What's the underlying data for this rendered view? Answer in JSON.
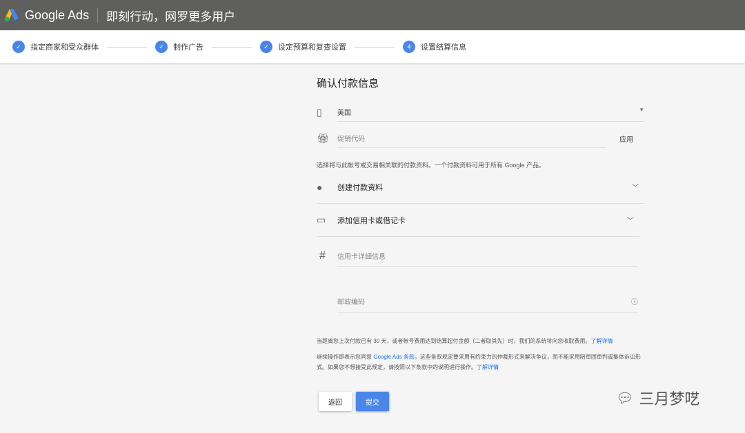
{
  "header": {
    "brand": "Google Ads",
    "tagline": "即刻行动，网罗更多用户"
  },
  "steps": [
    {
      "label": "指定商家和受众群体",
      "state": "done"
    },
    {
      "label": "制作广告",
      "state": "done"
    },
    {
      "label": "设定预算和复查设置",
      "state": "done"
    },
    {
      "label": "设置结算信息",
      "number": "4",
      "state": "current"
    }
  ],
  "form": {
    "title": "确认付款信息",
    "country": "美国",
    "promo_placeholder": "促销代码",
    "apply": "应用",
    "profile_note": "选择将与此帐号或交易相关联的付款资料。一个付款资料可用于所有 Google 产品。",
    "create_profile": "创建付款资料",
    "add_card": "添加信用卡或借记卡",
    "card_placeholder": "信用卡详细信息",
    "zip_placeholder": "邮政编码",
    "billing_note": "当距离您上次付款已有 30 天，或者帐号费用达到结算起付金额（二者取其先）时，我们的系统将向您收取费用。",
    "learn_more": "了解详情",
    "terms_pre": "继续操作即表示您同意 ",
    "terms_link": "Google Ads 条款",
    "terms_post": "。这些条款规定要采用有约束力的仲裁形式来解决争议，而不能采用陪审团审判或集体诉讼形式。如果您不想接受此规定，请按照以下条款中的说明进行操作。",
    "learn_more2": "了解详情",
    "back": "返回",
    "submit": "提交"
  },
  "watermark": "三月梦呓"
}
